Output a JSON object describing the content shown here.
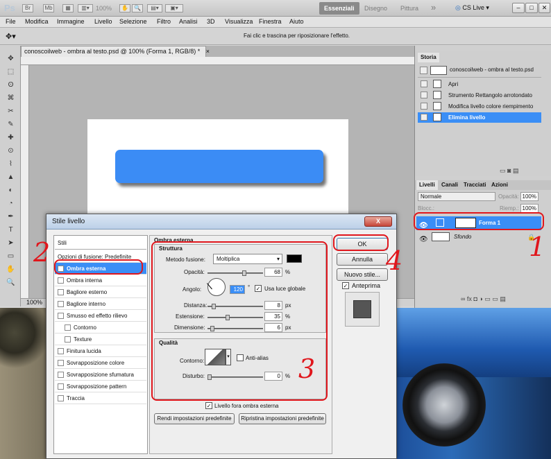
{
  "app": {
    "logo": "Ps",
    "zoom": "100%",
    "workspaces": [
      "Essenziali",
      "Disegno",
      "Pittura"
    ],
    "more": "»",
    "cslive": "CS Live"
  },
  "menu": [
    "File",
    "Modifica",
    "Immagine",
    "Livello",
    "Selezione",
    "Filtro",
    "Analisi",
    "3D",
    "Visualizza",
    "Finestra",
    "Aiuto"
  ],
  "options": {
    "hint": "Fai clic e trascina per riposizionare l'effetto."
  },
  "document": {
    "tab": "conoscoilweb - ombra al testo.psd @ 100% (Forma 1, RGB/8) *",
    "close": "×",
    "zoom": "100%"
  },
  "history": {
    "tab": "Storia",
    "snapshot": "conoscoilweb - ombra al testo.psd",
    "items": [
      "Apri",
      "Strumento Rettangolo arrotondato",
      "Modifica livello colore riempimento",
      "Elimina livello"
    ],
    "selected_index": 3
  },
  "layers": {
    "tabs": [
      "Livelli",
      "Canali",
      "Tracciati",
      "Azioni"
    ],
    "blend": "Normale",
    "opacity_label": "Opacità:",
    "opacity": "100%",
    "lock_label": "Blocc.:",
    "fill_label": "Riemp.:",
    "fill": "100%",
    "items": [
      {
        "name": "Forma 1",
        "selected": true
      },
      {
        "name": "Sfondo",
        "selected": false
      }
    ]
  },
  "dialog": {
    "title": "Stile livello",
    "close": "X",
    "list": [
      {
        "label": "Stili",
        "checkbox": false,
        "sub": false,
        "checked": false,
        "selected": false
      },
      {
        "label": "Opzioni di fusione: Predefinite",
        "checkbox": false,
        "sub": false,
        "checked": false,
        "selected": false
      },
      {
        "label": "Ombra esterna",
        "checkbox": true,
        "sub": false,
        "checked": true,
        "selected": true
      },
      {
        "label": "Ombra interna",
        "checkbox": true,
        "sub": false,
        "checked": false,
        "selected": false
      },
      {
        "label": "Bagliore esterno",
        "checkbox": true,
        "sub": false,
        "checked": false,
        "selected": false
      },
      {
        "label": "Bagliore interno",
        "checkbox": true,
        "sub": false,
        "checked": false,
        "selected": false
      },
      {
        "label": "Smusso ed effetto rilievo",
        "checkbox": true,
        "sub": false,
        "checked": false,
        "selected": false
      },
      {
        "label": "Contorno",
        "checkbox": true,
        "sub": true,
        "checked": false,
        "selected": false
      },
      {
        "label": "Texture",
        "checkbox": true,
        "sub": true,
        "checked": false,
        "selected": false
      },
      {
        "label": "Finitura lucida",
        "checkbox": true,
        "sub": false,
        "checked": false,
        "selected": false
      },
      {
        "label": "Sovrapposizione colore",
        "checkbox": true,
        "sub": false,
        "checked": false,
        "selected": false
      },
      {
        "label": "Sovrapposizione sfumatura",
        "checkbox": true,
        "sub": false,
        "checked": false,
        "selected": false
      },
      {
        "label": "Sovrapposizione pattern",
        "checkbox": true,
        "sub": false,
        "checked": false,
        "selected": false
      },
      {
        "label": "Traccia",
        "checkbox": true,
        "sub": false,
        "checked": false,
        "selected": false
      }
    ],
    "section_title": "Ombra esterna",
    "structure": {
      "title": "Struttura",
      "blend_label": "Metodo fusione:",
      "blend_value": "Moltiplica",
      "shadow_color": "#000000",
      "opacity_label": "Opacità:",
      "opacity": "68",
      "angle_label": "Angolo:",
      "angle": "120",
      "degree": "°",
      "global_light_label": "Usa luce globale",
      "global_light": true,
      "distance_label": "Distanza:",
      "distance": "8",
      "spread_label": "Estensione:",
      "spread": "35",
      "size_label": "Dimensione:",
      "size": "6",
      "unit_px": "px",
      "unit_pct": "%"
    },
    "quality": {
      "title": "Qualità",
      "contour_label": "Contorno:",
      "antialias_label": "Anti-alias",
      "antialias": false,
      "noise_label": "Disturbo:",
      "noise": "0",
      "unit_pct": "%",
      "knockout_label": "Livello fora ombra esterna",
      "knockout": true
    },
    "buttons": {
      "make_default": "Rendi impostazioni predefinite",
      "reset_default": "Ripristina impostazioni predefinite",
      "ok": "OK",
      "cancel": "Annulla",
      "new_style": "Nuovo stile...",
      "preview_label": "Anteprima",
      "preview": true
    }
  },
  "annotations": [
    "1",
    "2",
    "3",
    "4"
  ],
  "colors": {
    "accent": "#3a8ef6",
    "shape": "#3b8cf5",
    "annotation": "#e0161c"
  },
  "slider_levels": {
    "opacity": 0.68,
    "distance": 0.08,
    "spread": 0.35,
    "size": 0.06,
    "noise": 0.0
  }
}
